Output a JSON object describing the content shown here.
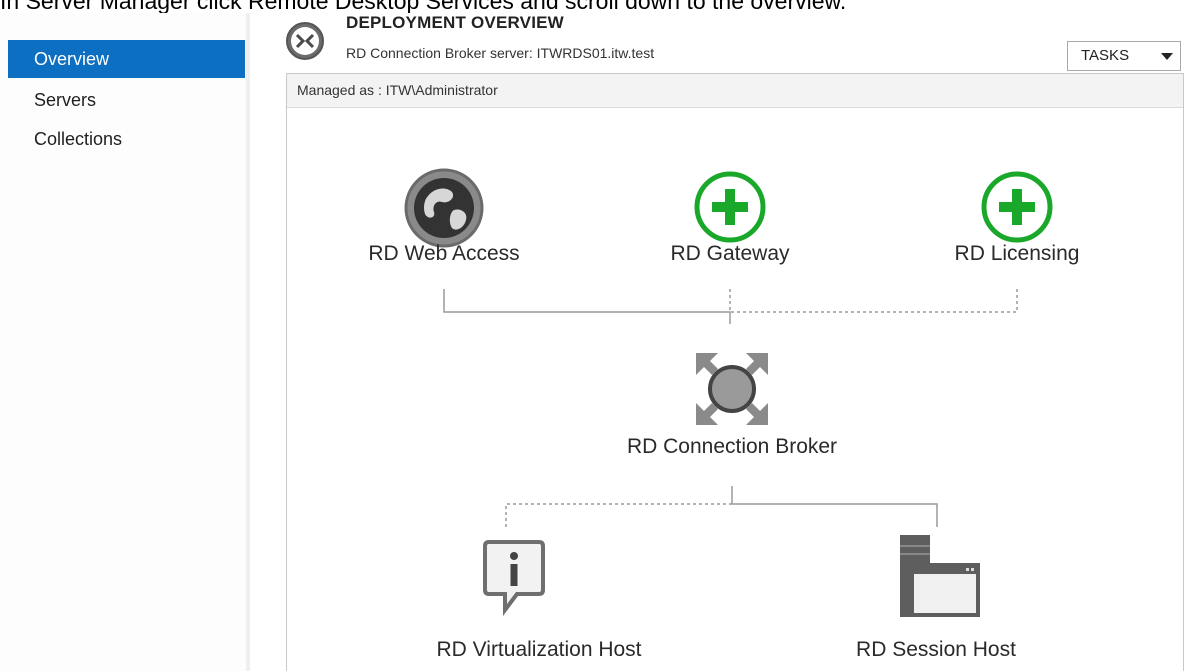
{
  "caption": "In Server Manager click Remote Desktop Services and scroll down to the overview.",
  "sidebar": {
    "items": [
      {
        "label": "Overview",
        "selected": true
      },
      {
        "label": "Servers",
        "selected": false
      },
      {
        "label": "Collections",
        "selected": false
      }
    ]
  },
  "header": {
    "title": "DEPLOYMENT OVERVIEW",
    "subtitle": "RD Connection Broker server: ITWRDS01.itw.test",
    "tasks_label": "TASKS"
  },
  "panel": {
    "managed_as": "Managed as : ITW\\Administrator"
  },
  "roles": {
    "web_access": {
      "label": "RD Web Access",
      "icon": "globe-icon"
    },
    "gateway": {
      "label": "RD Gateway",
      "icon": "add-icon"
    },
    "licensing": {
      "label": "RD Licensing",
      "icon": "add-icon"
    },
    "broker": {
      "label": "RD Connection Broker",
      "icon": "broker-icon"
    },
    "virtualization": {
      "label": "RD Virtualization Host",
      "icon": "info-bubble-icon"
    },
    "session": {
      "label": "RD Session Host",
      "icon": "server-window-icon"
    }
  },
  "colors": {
    "selected_nav": "#0c6fc1",
    "add_green": "#1aa82a",
    "icon_gray": "#7a7a7a"
  }
}
